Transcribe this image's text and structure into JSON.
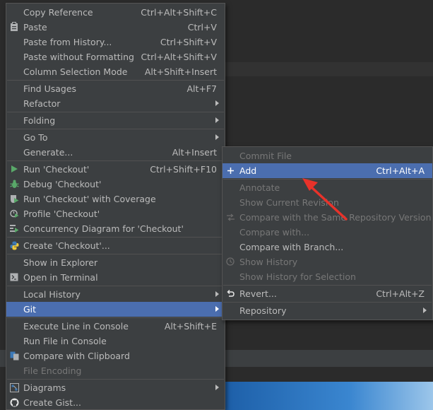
{
  "main_menu": {
    "items": [
      {
        "label": "Copy Reference",
        "shortcut": "Ctrl+Alt+Shift+C"
      },
      {
        "label": "Paste",
        "shortcut": "Ctrl+V"
      },
      {
        "label": "Paste from History...",
        "shortcut": "Ctrl+Shift+V"
      },
      {
        "label": "Paste without Formatting",
        "shortcut": "Ctrl+Alt+Shift+V"
      },
      {
        "label": "Column Selection Mode",
        "shortcut": "Alt+Shift+Insert"
      },
      {
        "label": "Find Usages",
        "shortcut": "Alt+F7"
      },
      {
        "label": "Refactor",
        "shortcut": ""
      },
      {
        "label": "Folding",
        "shortcut": ""
      },
      {
        "label": "Go To",
        "shortcut": ""
      },
      {
        "label": "Generate...",
        "shortcut": "Alt+Insert"
      },
      {
        "label": "Run 'Checkout'",
        "shortcut": "Ctrl+Shift+F10"
      },
      {
        "label": "Debug 'Checkout'",
        "shortcut": ""
      },
      {
        "label": "Run 'Checkout' with Coverage",
        "shortcut": ""
      },
      {
        "label": "Profile 'Checkout'",
        "shortcut": ""
      },
      {
        "label": "Concurrency Diagram for 'Checkout'",
        "shortcut": ""
      },
      {
        "label": "Create 'Checkout'...",
        "shortcut": ""
      },
      {
        "label": "Show in Explorer",
        "shortcut": ""
      },
      {
        "label": "Open in Terminal",
        "shortcut": ""
      },
      {
        "label": "Local History",
        "shortcut": ""
      },
      {
        "label": "Git",
        "shortcut": ""
      },
      {
        "label": "Execute Line in Console",
        "shortcut": "Alt+Shift+E"
      },
      {
        "label": "Run File in Console",
        "shortcut": ""
      },
      {
        "label": "Compare with Clipboard",
        "shortcut": ""
      },
      {
        "label": "File Encoding",
        "shortcut": ""
      },
      {
        "label": "Diagrams",
        "shortcut": ""
      },
      {
        "label": "Create Gist...",
        "shortcut": ""
      }
    ]
  },
  "git_submenu": {
    "items": [
      {
        "label": "Commit File",
        "shortcut": ""
      },
      {
        "label": "Add",
        "shortcut": "Ctrl+Alt+A"
      },
      {
        "label": "Annotate",
        "shortcut": ""
      },
      {
        "label": "Show Current Revision",
        "shortcut": ""
      },
      {
        "label": "Compare with the Same Repository Version",
        "shortcut": ""
      },
      {
        "label": "Compare with...",
        "shortcut": ""
      },
      {
        "label": "Compare with Branch...",
        "shortcut": ""
      },
      {
        "label": "Show History",
        "shortcut": ""
      },
      {
        "label": "Show History for Selection",
        "shortcut": ""
      },
      {
        "label": "Revert...",
        "shortcut": "Ctrl+Alt+Z"
      },
      {
        "label": "Repository",
        "shortcut": ""
      }
    ]
  },
  "colors": {
    "menu_bg": "#3c3f41",
    "selection": "#4b6eaf",
    "text": "#bbbbbb",
    "disabled_text": "#777777",
    "annotation_arrow": "#e8322a"
  }
}
